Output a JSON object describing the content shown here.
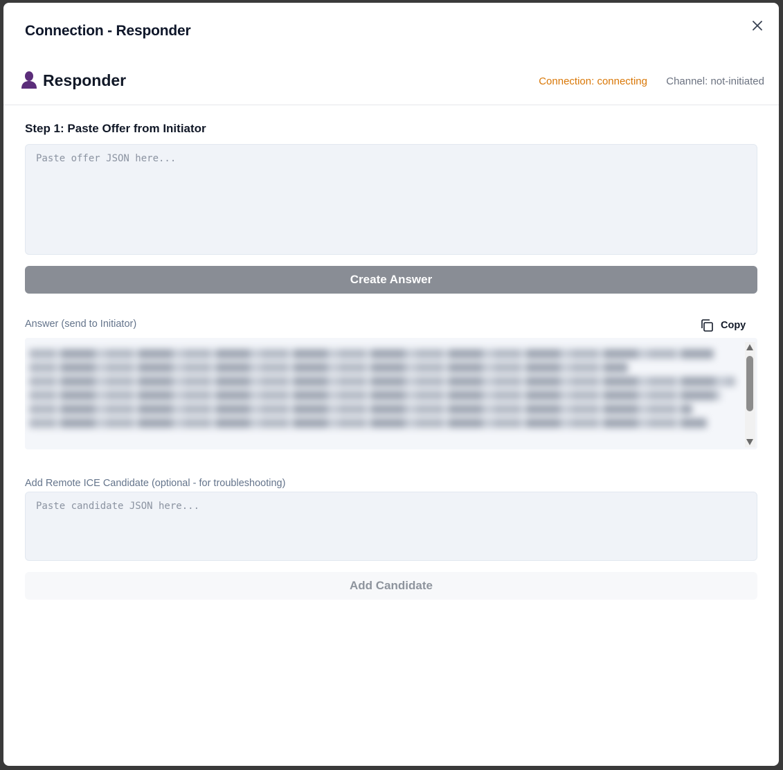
{
  "dialog": {
    "title": "Connection - Responder",
    "close_icon": "close-icon"
  },
  "header": {
    "role_icon": "user-silhouette-icon",
    "role_title": "Responder",
    "connection_status": "Connection: connecting",
    "channel_status": "Channel: not-initiated",
    "colors": {
      "connecting": "#d97706",
      "role_icon": "#5b2d7a"
    }
  },
  "step1": {
    "title": "Step 1: Paste Offer from Initiator",
    "offer_placeholder": "Paste offer JSON here...",
    "offer_value": "",
    "create_button": "Create Answer"
  },
  "answer": {
    "label": "Answer (send to Initiator)",
    "copy_label": "Copy",
    "copy_icon": "copy-icon",
    "content_blurred": true
  },
  "candidate": {
    "label": "Add Remote ICE Candidate (optional - for troubleshooting)",
    "placeholder": "Paste candidate JSON here...",
    "value": "",
    "add_button": "Add Candidate"
  }
}
